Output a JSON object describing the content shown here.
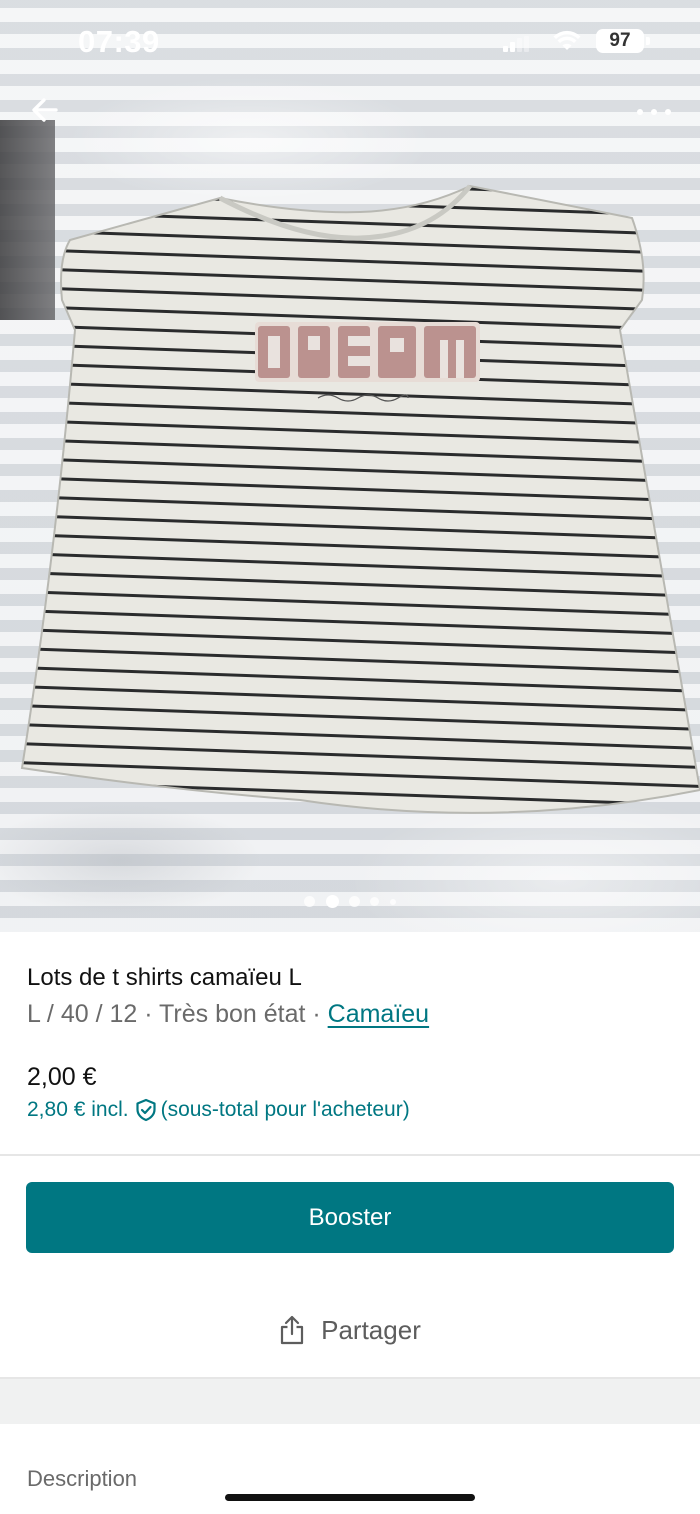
{
  "status_bar": {
    "time": "07:39",
    "battery": "97"
  },
  "nav": {
    "back_icon": "arrow-left-icon",
    "more_icon": "more-horizontal-icon"
  },
  "gallery": {
    "image_alt": "",
    "dots_count": 5,
    "active_index": 1
  },
  "item": {
    "title": "Lots de t shirts camaïeu L",
    "size": "L / 40 / 12",
    "separator": " · ",
    "condition": "Très bon état",
    "brand": "Camaïeu",
    "price": "2,00 €",
    "price_incl": "2,80 € incl.",
    "price_incl_note": "(sous-total pour l'acheteur)",
    "shield_icon": "shield-check-icon"
  },
  "actions": {
    "booster_label": "Booster",
    "share_label": "Partager",
    "share_icon": "share-icon"
  },
  "sections": {
    "description_label": "Description"
  },
  "colors": {
    "accent": "#007782",
    "text_primary": "#111111",
    "text_secondary": "#6a6a6a"
  }
}
